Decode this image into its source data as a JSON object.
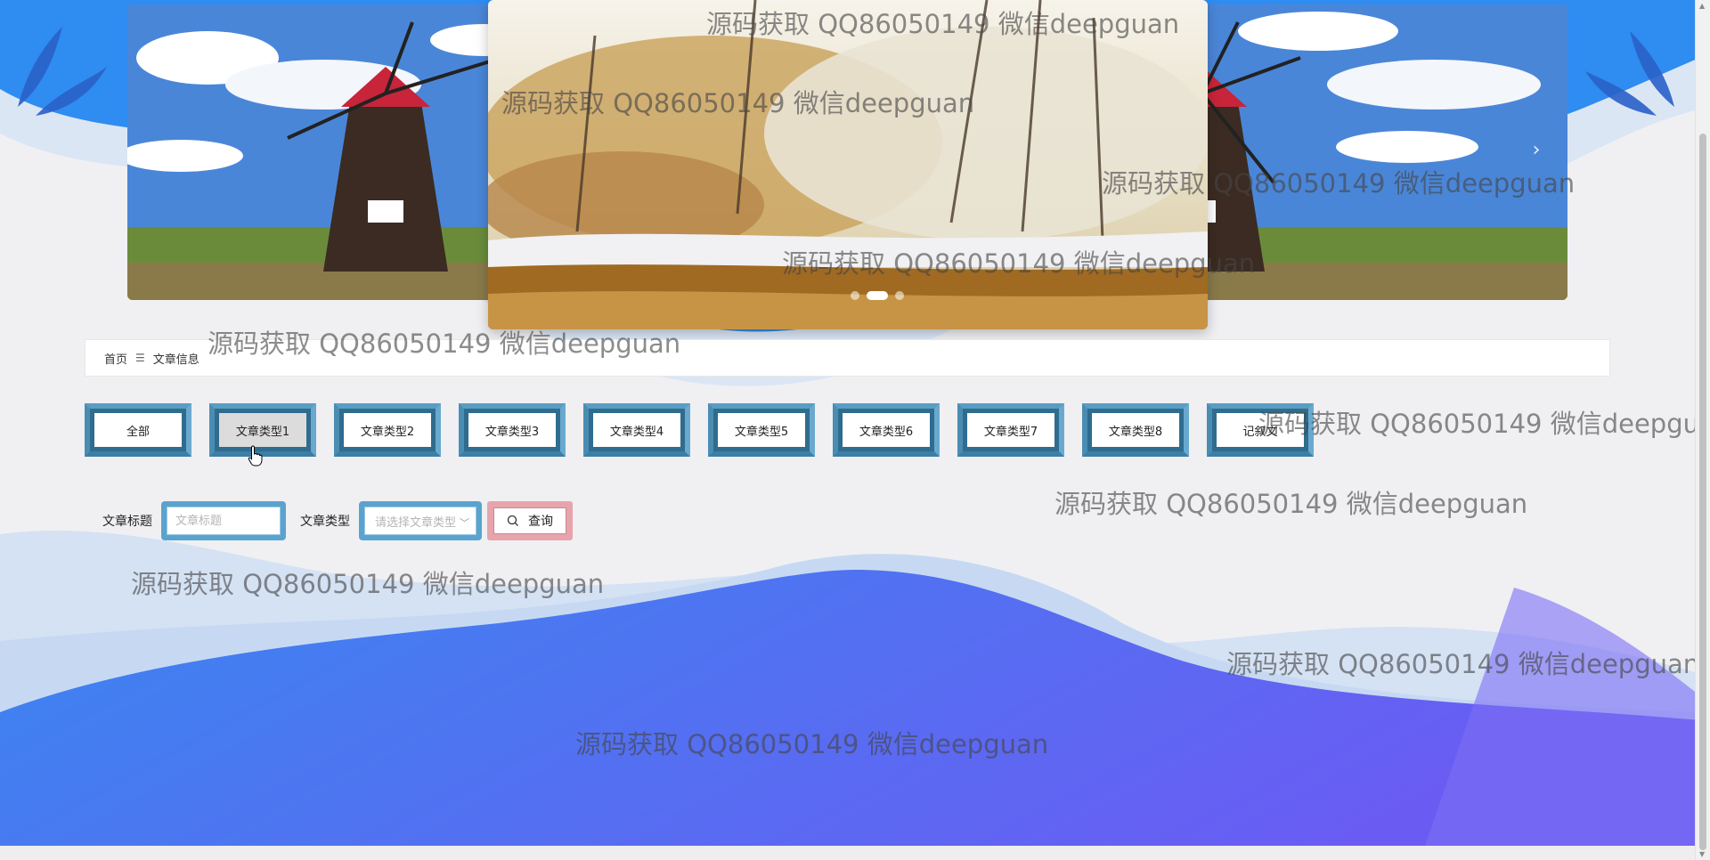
{
  "carousel": {
    "prev_label": "‹",
    "next_label": "›",
    "slides": [
      "windmill",
      "snow-forest",
      "windmill"
    ],
    "dot_count": 3,
    "active_dot": 1
  },
  "breadcrumb": {
    "home": "首页",
    "separator": "☰",
    "current": "文章信息"
  },
  "categories": [
    {
      "label": "全部",
      "active": false
    },
    {
      "label": "文章类型1",
      "active": true
    },
    {
      "label": "文章类型2",
      "active": false
    },
    {
      "label": "文章类型3",
      "active": false
    },
    {
      "label": "文章类型4",
      "active": false
    },
    {
      "label": "文章类型5",
      "active": false
    },
    {
      "label": "文章类型6",
      "active": false
    },
    {
      "label": "文章类型7",
      "active": false
    },
    {
      "label": "文章类型8",
      "active": false
    },
    {
      "label": "记叙文",
      "active": false
    }
  ],
  "search": {
    "title_label": "文章标题",
    "title_placeholder": "文章标题",
    "type_label": "文章类型",
    "type_placeholder": "请选择文章类型",
    "button_label": "查询",
    "search_icon": "search-icon"
  },
  "watermark": "源码获取 QQ86050149 微信deepguan",
  "colors": {
    "wave_blue": "#3d7ff0",
    "wave_purple": "#6a5cf3",
    "button_blue": "#5ba3cf",
    "button_pink": "#e7a4ac"
  }
}
